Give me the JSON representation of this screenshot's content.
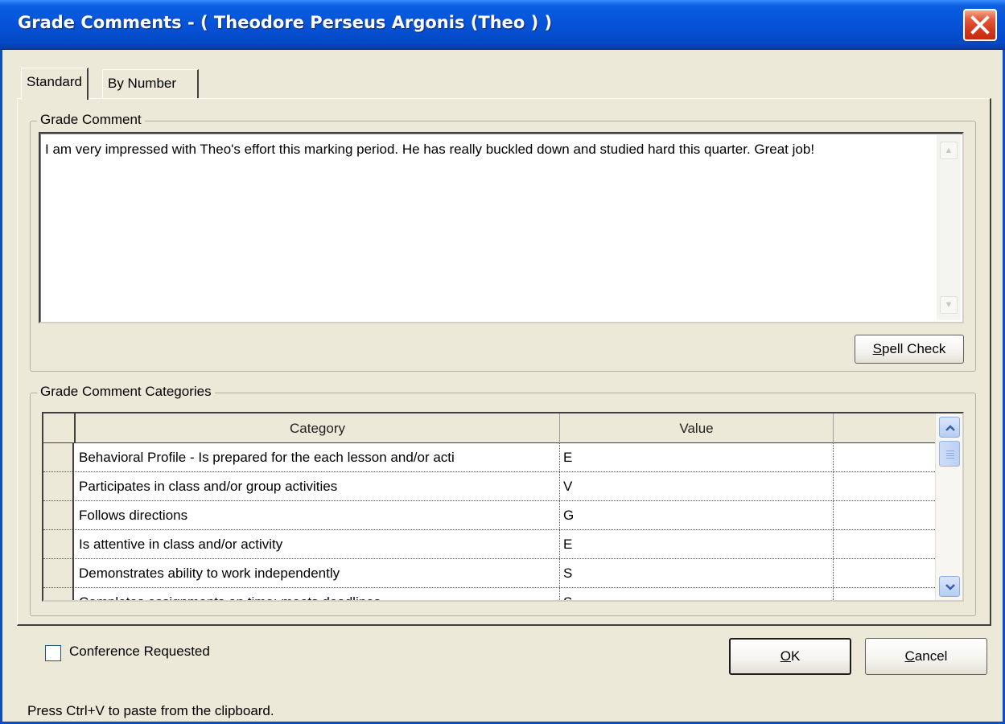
{
  "window": {
    "title": "Grade Comments - ( Theodore Perseus Argonis (Theo ) )",
    "close_label": "Close"
  },
  "tabs": [
    {
      "label": "Standard",
      "active": true
    },
    {
      "label": "By Number",
      "active": false
    }
  ],
  "grade_comment": {
    "legend": "Grade Comment",
    "text": "I am very impressed with Theo's effort this marking period. He has really buckled down and studied hard this quarter. Great job!",
    "spell_check_prefix": "S",
    "spell_check_rest": "pell Check"
  },
  "categories": {
    "legend": "Grade Comment Categories",
    "columns": [
      "Category",
      "Value",
      ""
    ],
    "rows": [
      {
        "category": "Behavioral Profile - Is prepared for the each lesson and/or acti",
        "value": "E"
      },
      {
        "category": "Participates in class and/or group activities",
        "value": "V"
      },
      {
        "category": "Follows directions",
        "value": "G"
      },
      {
        "category": "Is attentive in class and/or activity",
        "value": "E"
      },
      {
        "category": "Demonstrates ability to work independently",
        "value": "S"
      },
      {
        "category": "Completes assignments on time; meets deadlines",
        "value": "S"
      }
    ]
  },
  "footer": {
    "conference_label": "Conference Requested",
    "conference_checked": false,
    "ok_prefix": "O",
    "ok_rest": "K",
    "cancel_prefix": "C",
    "cancel_rest": "ancel",
    "status": "Press Ctrl+V to paste from the clipboard."
  },
  "colors": {
    "titlebar": "#0652d8",
    "dialog_bg": "#ece9d8",
    "close_button": "#d2361a"
  }
}
